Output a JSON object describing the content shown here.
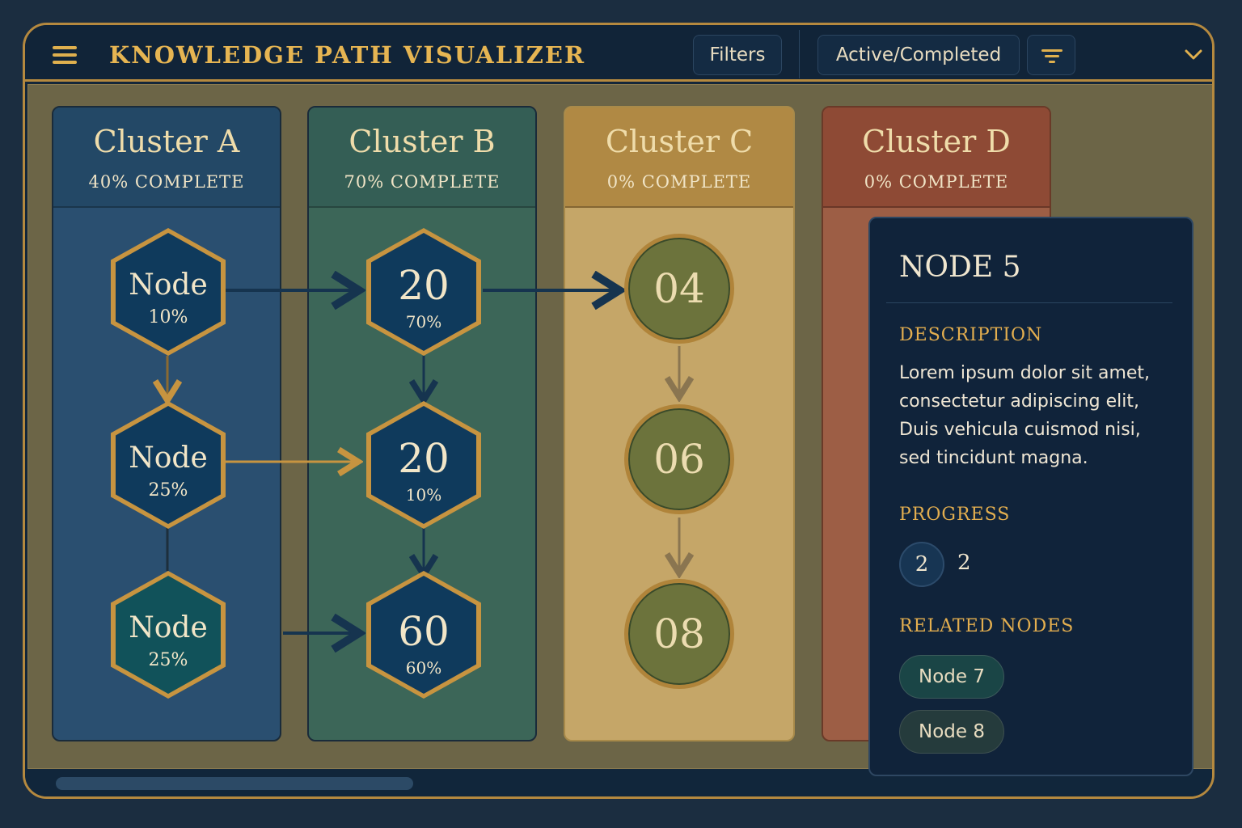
{
  "header": {
    "title": "KNOWLEDGE PATH VISUALIZER",
    "filters_label": "Filters",
    "status_label": "Active/Completed",
    "menu_icon": "hamburger-menu-icon",
    "sort_icon": "sort-filter-icon",
    "dropdown_icon": "chevron-down-icon"
  },
  "clusters": [
    {
      "name": "Cluster A",
      "progress": "40% COMPLETE",
      "color": "#2a4f70",
      "nodes": [
        {
          "label": "Node",
          "percent": "10%"
        },
        {
          "label": "Node",
          "percent": "25%"
        },
        {
          "label": "Node",
          "percent": "25%"
        }
      ]
    },
    {
      "name": "Cluster B",
      "progress": "70% COMPLETE",
      "color": "#3c6658",
      "nodes": [
        {
          "label": "20",
          "percent": "70%"
        },
        {
          "label": "20",
          "percent": "10%"
        },
        {
          "label": "60",
          "percent": "60%"
        }
      ]
    },
    {
      "name": "Cluster C",
      "progress": "0% COMPLETE",
      "color": "#c5a668",
      "nodes": [
        {
          "label": "04"
        },
        {
          "label": "06"
        },
        {
          "label": "08"
        }
      ]
    },
    {
      "name": "Cluster D",
      "progress": "0% COMPLETE",
      "color": "#9d5e45"
    }
  ],
  "details": {
    "title": "NODE 5",
    "description_heading": "DESCRIPTION",
    "description": "Lorem ipsum dolor sit amet, consectetur adipiscing elit, Duis vehicula cuismod nisi, sed tincidunt magna.",
    "progress_heading": "PROGRESS",
    "progress_badge": "2",
    "progress_value": "2",
    "related_heading": "RELATED NODES",
    "related": [
      "Node 7",
      "Node 8"
    ]
  },
  "colors": {
    "accent_gold": "#e3ae4f",
    "frame_navy": "#13263a",
    "node_blue": "#0f3a5c",
    "node_teal": "#11525a",
    "node_olive": "#6c733c"
  }
}
